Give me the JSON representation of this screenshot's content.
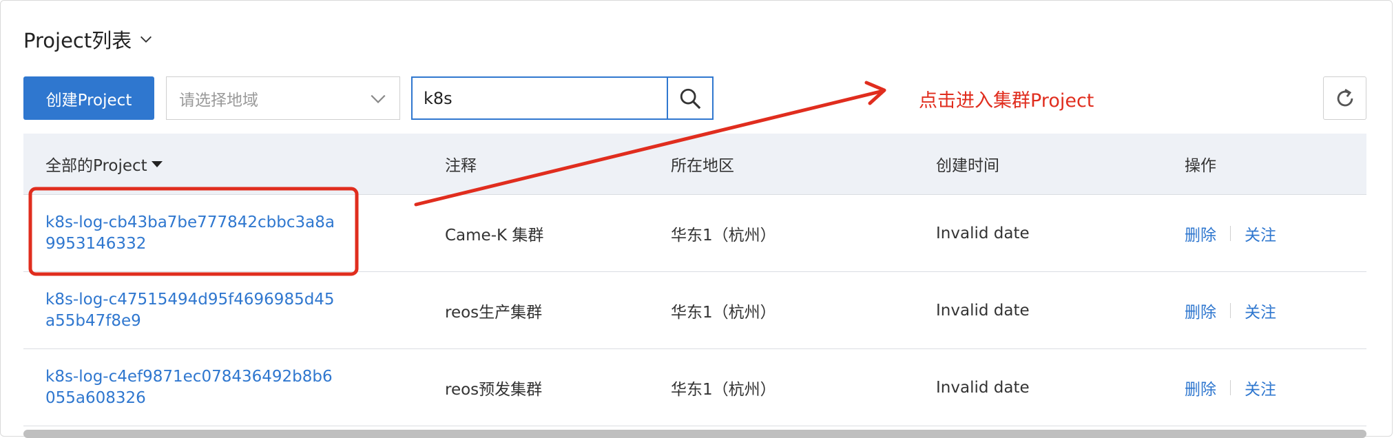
{
  "header": {
    "title": "Project列表",
    "title_icon": "chevron-down-icon"
  },
  "toolbar": {
    "create_label": "创建Project",
    "region_placeholder": "请选择地域",
    "search_value": "k8s",
    "search_icon": "search-icon",
    "refresh_icon": "refresh-icon"
  },
  "annotation": {
    "text": "点击进入集群Project",
    "color": "#e02d1e"
  },
  "table": {
    "columns": [
      "全部的Project",
      "注释",
      "所在地区",
      "创建时间",
      "操作"
    ],
    "rows": [
      {
        "name": "k8s-log-cb43ba7be777842cbbc3a8a9953146332",
        "note": "Came-K 集群",
        "region": "华东1（杭州）",
        "created": "Invalid date",
        "op_delete": "删除",
        "op_follow": "关注"
      },
      {
        "name": "k8s-log-c47515494d95f4696985d45a55b47f8e9",
        "note": "reos生产集群",
        "region": "华东1（杭州）",
        "created": "Invalid date",
        "op_delete": "删除",
        "op_follow": "关注"
      },
      {
        "name": "k8s-log-c4ef9871ec078436492b8b6055a608326",
        "note": "reos预发集群",
        "region": "华东1（杭州）",
        "created": "Invalid date",
        "op_delete": "删除",
        "op_follow": "关注"
      }
    ]
  },
  "colors": {
    "primary": "#2f77cf",
    "header_bg": "#eef1f6",
    "annotation_red": "#e02d1e"
  }
}
